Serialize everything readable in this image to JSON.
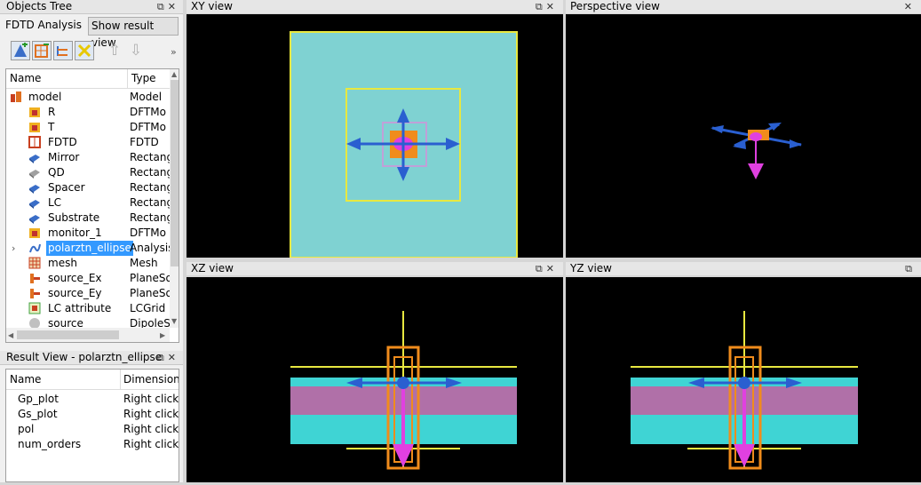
{
  "objects_tree": {
    "title": "Objects Tree",
    "tabs": [
      "FDTD Analysis",
      "Show result view"
    ],
    "columns": [
      "Name",
      "Type"
    ],
    "items": [
      {
        "name": "model",
        "type": "Model",
        "icon": "model-icon"
      },
      {
        "name": "R",
        "type": "DFTMo",
        "icon": "monitor-icon"
      },
      {
        "name": "T",
        "type": "DFTMo",
        "icon": "monitor-icon"
      },
      {
        "name": "FDTD",
        "type": "FDTD",
        "icon": "fdtd-icon"
      },
      {
        "name": "Mirror",
        "type": "Rectang",
        "icon": "rectangle-blue-icon"
      },
      {
        "name": "QD",
        "type": "Rectang",
        "icon": "rectangle-gray-icon"
      },
      {
        "name": "Spacer",
        "type": "Rectang",
        "icon": "rectangle-blue-icon"
      },
      {
        "name": "LC",
        "type": "Rectang",
        "icon": "rectangle-blue-icon"
      },
      {
        "name": "Substrate",
        "type": "Rectang",
        "icon": "rectangle-blue-icon"
      },
      {
        "name": "monitor_1",
        "type": "DFTMo",
        "icon": "monitor-icon"
      },
      {
        "name": "polarztn_ellipse",
        "type": "Analysis",
        "icon": "analysis-icon",
        "selected": true
      },
      {
        "name": "mesh",
        "type": "Mesh",
        "icon": "mesh-icon"
      },
      {
        "name": "source_Ex",
        "type": "PlaneSo",
        "icon": "plane-source-icon"
      },
      {
        "name": "source_Ey",
        "type": "PlaneSo",
        "icon": "plane-source-icon"
      },
      {
        "name": "LC attribute",
        "type": "LCGrid",
        "icon": "lc-grid-icon"
      },
      {
        "name": "source",
        "type": "DipoleS",
        "icon": "dipole-icon"
      }
    ]
  },
  "result_view": {
    "title": "Result View - polarztn_ellipse",
    "columns": [
      "Name",
      "Dimensions"
    ],
    "items": [
      {
        "name": "Gp_plot",
        "dimensions": "Right click t"
      },
      {
        "name": "Gs_plot",
        "dimensions": "Right click t"
      },
      {
        "name": "pol",
        "dimensions": "Right click t"
      },
      {
        "name": "num_orders",
        "dimensions": "Right click t"
      }
    ]
  },
  "views": {
    "xy": "XY view",
    "perspective": "Perspective view",
    "xz": "XZ view",
    "yz": "YZ view"
  },
  "colors": {
    "selection": "#3399ff",
    "substrate": "#7fd2d2",
    "layer_cyan": "#3fd4d4",
    "layer_violet": "#b070a8",
    "outline_yellow": "#e8e840",
    "source_orange": "#f08c1c",
    "arrow_blue": "#2a5fd0",
    "magenta": "#e040e0"
  }
}
